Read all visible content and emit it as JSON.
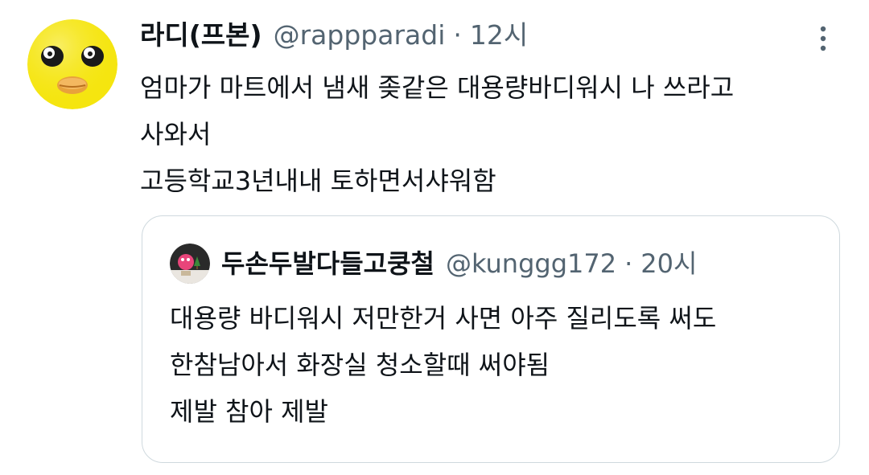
{
  "tweet": {
    "author": {
      "display_name": "라디(프본)",
      "handle": "@rappparadi",
      "avatar_icon": "yellow-duck-face-avatar"
    },
    "separator": "·",
    "time": "12시",
    "more_icon": "more-vertical-icon",
    "text_lines": [
      "엄마가 마트에서 냄새 좆같은 대용량바디워시 나 쓰라고",
      "사와서",
      "고등학교3년내내 토하면서샤워함"
    ]
  },
  "quoted_tweet": {
    "author": {
      "display_name": "두손두발다들고쿵철",
      "handle": "@kunggg172",
      "avatar_icon": "character-avatar"
    },
    "separator": "·",
    "time": "20시",
    "text_lines": [
      "대용량 바디워시 저만한거 사면 아주 질리도록 써도",
      "한참남아서 화장실 청소할때 써야됨",
      "제발 참아 제발"
    ]
  },
  "colors": {
    "text_primary": "#0f1419",
    "text_secondary": "#536471",
    "border": "#cfd9de",
    "avatar_yellow": "#f5e50f"
  }
}
